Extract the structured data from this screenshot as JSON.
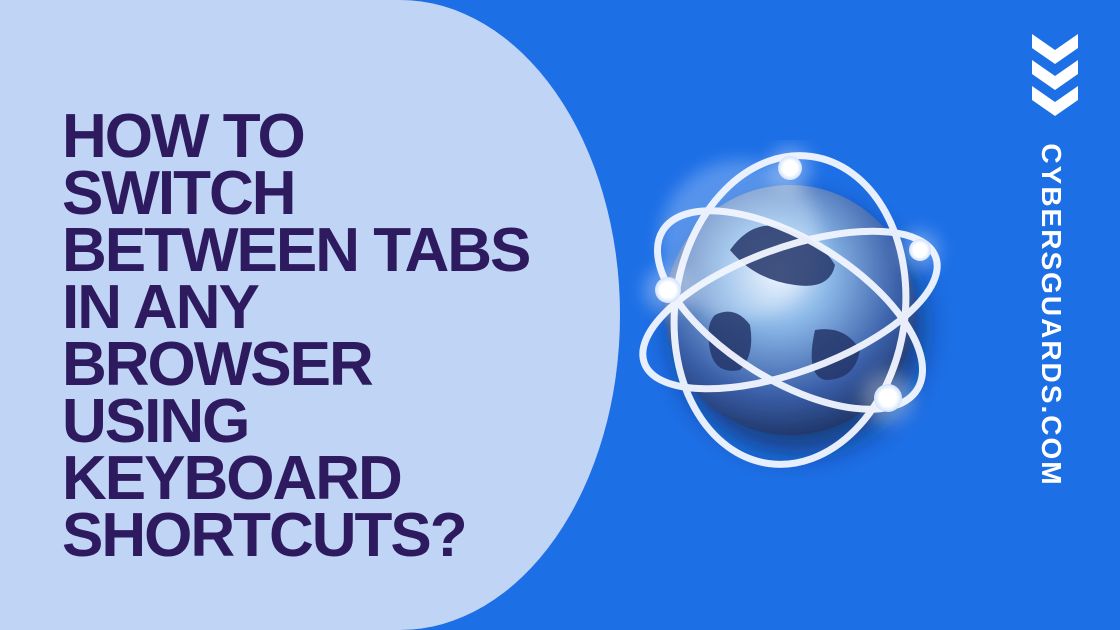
{
  "headline": "HOW TO SWITCH BETWEEN TABS IN ANY BROWSER USING KEYBOARD SHORTCUTS?",
  "brand": "CYBERSGUARDS.COM",
  "colors": {
    "bg_right": "#1d6fe6",
    "bg_left": "#c0d4f5",
    "headline": "#2e1a5e",
    "brand_text": "#ffffff"
  },
  "icons": {
    "chevrons": "chevron-down-triple",
    "hero": "globe-network"
  }
}
